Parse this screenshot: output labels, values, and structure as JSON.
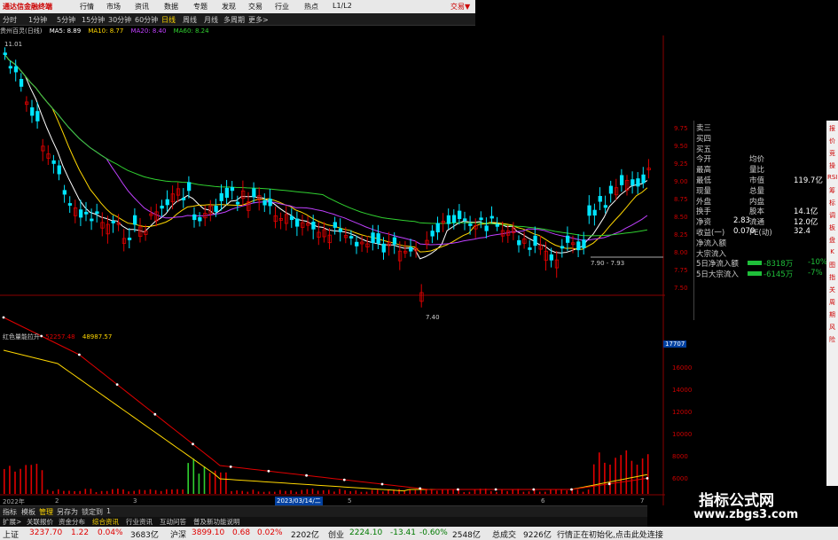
{
  "app": {
    "title": "通达信金融终端",
    "trade_button": "交易▼"
  },
  "menu": [
    "行情",
    "市场",
    "资讯",
    "数据",
    "专题",
    "发现",
    "交易",
    "行业",
    "热点",
    "L1/L2"
  ],
  "periods": [
    "分时",
    "1分钟",
    "5分钟",
    "15分钟",
    "30分钟",
    "60分钟",
    "日线",
    "周线",
    "月线",
    "多周期",
    "更多>"
  ],
  "active_period": "日线",
  "ma_legend": {
    "stock": "贵州百灵(日线)",
    "ma5": "MA5: 8.89",
    "ma10": "MA10: 8.77",
    "ma20": "MA20: 8.40",
    "ma60": "MA60: 8.24"
  },
  "price_chart": {
    "price_axis": [
      "9.75",
      "9.50",
      "9.25",
      "9.00",
      "8.75",
      "8.50",
      "8.25",
      "8.00",
      "7.75",
      "7.50"
    ],
    "high_label": "11.01",
    "low_label": "7.40",
    "range_label": "7.90 - 7.93"
  },
  "indicator": {
    "name": "红色量能拉升",
    "value1": "52257.48",
    "value2": "48987.57",
    "axis": [
      "16000",
      "14000",
      "12000",
      "10000",
      "8000",
      "6000",
      "4000"
    ],
    "top_value": "17707"
  },
  "time_axis": {
    "year": "2022年",
    "marks": [
      "2",
      "3",
      "5",
      "6",
      "7"
    ],
    "cursor_date": "2023/03/14/二"
  },
  "quote_panel": {
    "rows": [
      {
        "label": "卖三"
      },
      {
        "label": "买四"
      },
      {
        "label": "买五"
      },
      {
        "label": "今开",
        "label2": "均价"
      },
      {
        "label": "最高",
        "label2": "量比"
      },
      {
        "label": "最低",
        "label2": "市值",
        "value2": "119.7亿"
      },
      {
        "label": "现量",
        "label2": "总量"
      },
      {
        "label": "外盘",
        "label2": "内盘"
      },
      {
        "label": "换手",
        "label2": "股本",
        "value2": "14.1亿"
      },
      {
        "label": "净资",
        "value": "2.83",
        "label2": "流通",
        "value2": "12.0亿"
      },
      {
        "label": "收益(一)",
        "value": "0.070",
        "label2": "PE(动)",
        "value2": "32.4"
      },
      {
        "label": "净流入额"
      },
      {
        "label": "大宗流入"
      },
      {
        "label": "5日净流入额",
        "value": "-8318万",
        "pct": "-10%"
      },
      {
        "label": "5日大宗流入",
        "value": "-6145万",
        "pct": "-7%"
      }
    ]
  },
  "side_toolbar": [
    "报",
    "价",
    "竞",
    "操",
    "RSI",
    "筹",
    "标",
    "调",
    "板",
    "盘",
    "K",
    "图",
    "指",
    "关",
    "周",
    "期",
    "风",
    "险"
  ],
  "bottom_tabs": [
    "指标",
    "模板",
    "管理",
    "另存为",
    "锁定到",
    "1"
  ],
  "bottom_tabs2": [
    "扩展>",
    "关联报价",
    "资金分布",
    "综合资讯",
    "行业资讯",
    "互动问答",
    "普及新功能说明"
  ],
  "status": {
    "sh_label": "上证",
    "sh_value": "3237.70",
    "sh_change": "1.22",
    "sh_pct": "0.04%",
    "sh_amount": "3683亿",
    "sz_label": "沪深",
    "sz_value": "3899.10",
    "sz_change": "0.68",
    "sz_pct": "0.02%",
    "sz_amount": "2202亿",
    "cy_label": "创业",
    "cy_value": "2224.10",
    "cy_change": "-13.41",
    "cy_pct": "-0.60%",
    "cy_amount": "2548亿",
    "total_label": "总成交",
    "total_amount": "9226亿",
    "message": "行情正在初始化,点击此处连接"
  },
  "watermark": {
    "line1": "指标公式网",
    "line2": "www.zbgs3.com"
  },
  "colors": {
    "up": "#e00000",
    "down": "#00e5ff",
    "ma5": "#ffffff",
    "ma10": "#ffd700",
    "ma20": "#c040ff",
    "ma60": "#30d030"
  }
}
